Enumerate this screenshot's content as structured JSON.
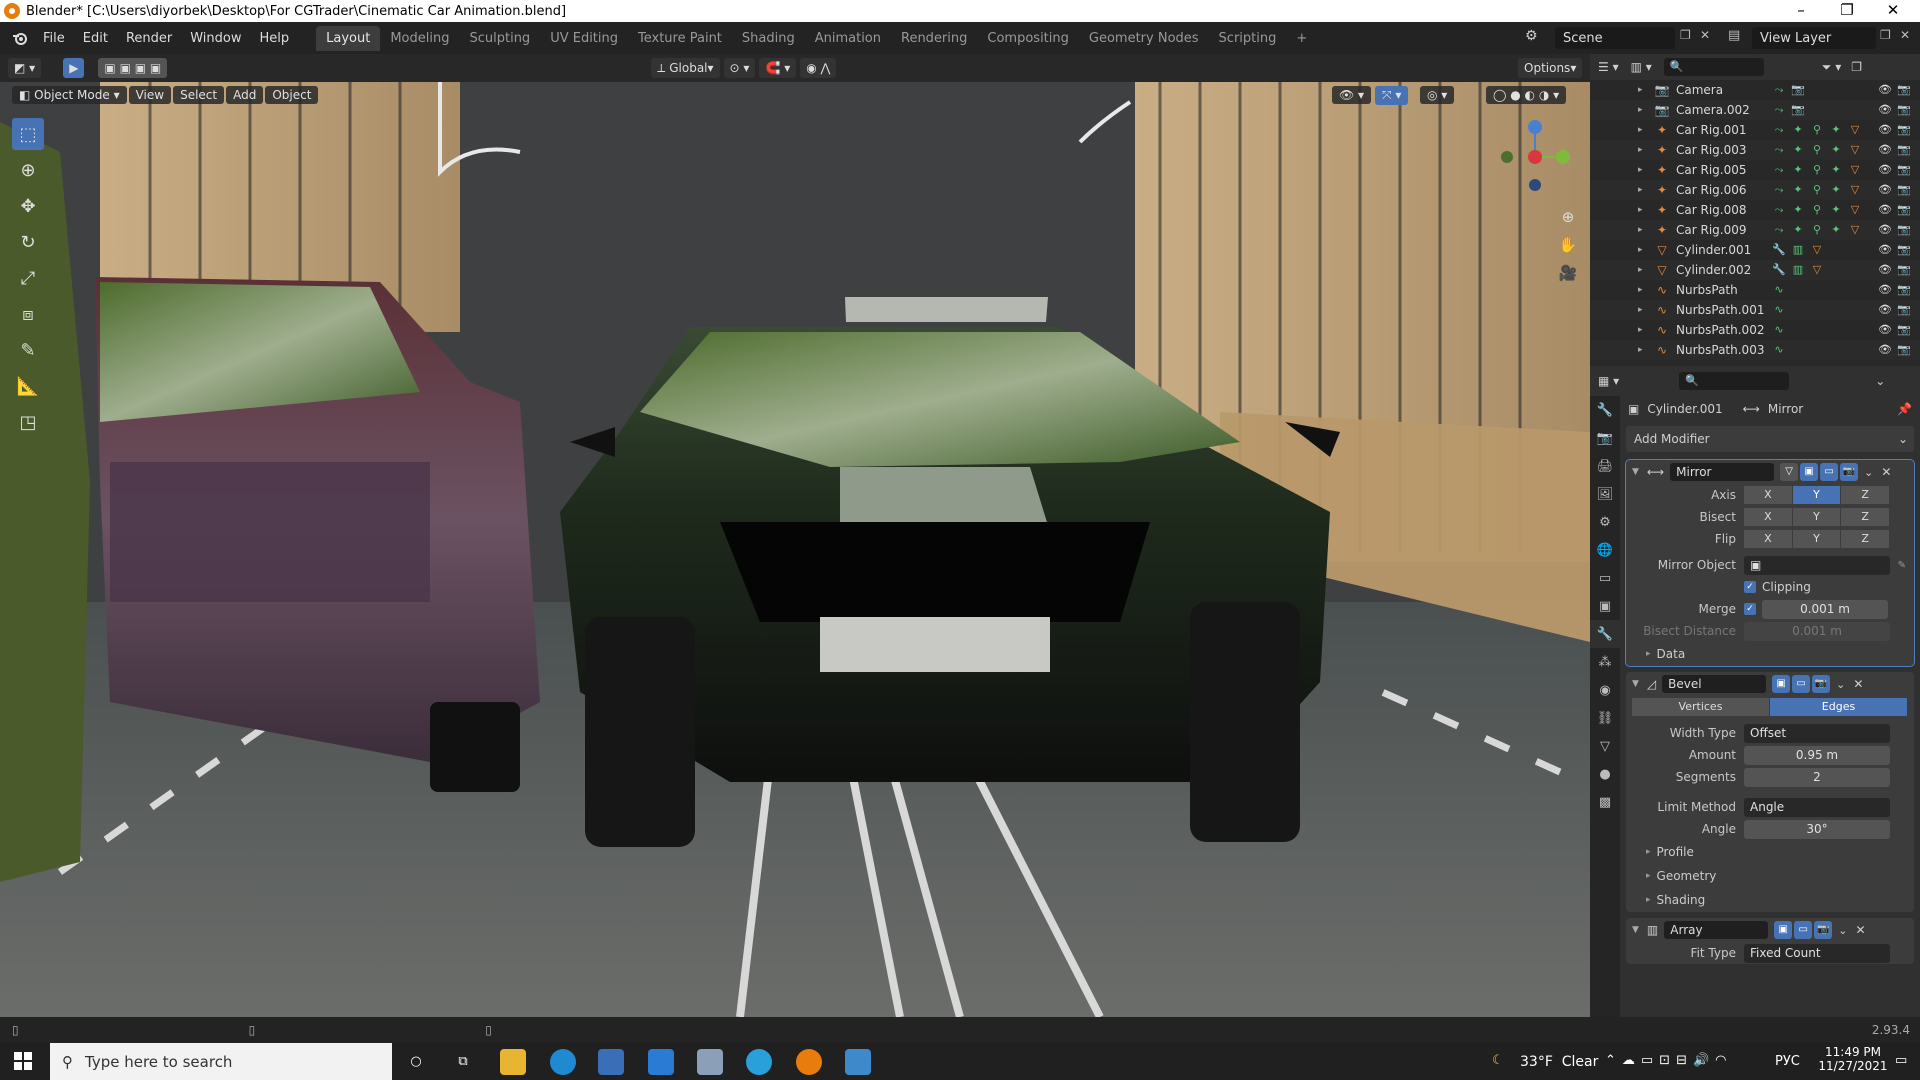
{
  "window": {
    "title": "Blender* [C:\\Users\\diyorbek\\Desktop\\For CGTrader\\Cinematic Car Animation.blend]"
  },
  "menubar": {
    "items": [
      "File",
      "Edit",
      "Render",
      "Window",
      "Help"
    ]
  },
  "workspaces": [
    "Layout",
    "Modeling",
    "Sculpting",
    "UV Editing",
    "Texture Paint",
    "Shading",
    "Animation",
    "Rendering",
    "Compositing",
    "Geometry Nodes",
    "Scripting",
    "+"
  ],
  "topright": {
    "scene": "Scene",
    "view_layer": "View Layer"
  },
  "viewport_header": {
    "orientation": "Global",
    "options": "Options"
  },
  "viewport_menu": {
    "mode": "Object Mode",
    "items": [
      "View",
      "Select",
      "Add",
      "Object"
    ]
  },
  "outliner": {
    "items": [
      {
        "label": "Camera",
        "icon": "camera-icon"
      },
      {
        "label": "Camera.002",
        "icon": "camera-icon"
      },
      {
        "label": "Car Rig.001",
        "icon": "armature-icon"
      },
      {
        "label": "Car Rig.003",
        "icon": "armature-icon"
      },
      {
        "label": "Car Rig.005",
        "icon": "armature-icon"
      },
      {
        "label": "Car Rig.006",
        "icon": "armature-icon"
      },
      {
        "label": "Car Rig.008",
        "icon": "armature-icon"
      },
      {
        "label": "Car Rig.009",
        "icon": "armature-icon"
      },
      {
        "label": "Cylinder.001",
        "icon": "mesh-icon"
      },
      {
        "label": "Cylinder.002",
        "icon": "mesh-icon"
      },
      {
        "label": "NurbsPath",
        "icon": "curve-icon"
      },
      {
        "label": "NurbsPath.001",
        "icon": "curve-icon"
      },
      {
        "label": "NurbsPath.002",
        "icon": "curve-icon"
      },
      {
        "label": "NurbsPath.003",
        "icon": "curve-icon"
      }
    ]
  },
  "properties": {
    "object": "Cylinder.001",
    "modifier_context": "Mirror",
    "add_modifier": "Add Modifier",
    "mirror": {
      "name": "Mirror",
      "axis_label": "Axis",
      "bisect_label": "Bisect",
      "flip_label": "Flip",
      "x": "X",
      "y": "Y",
      "z": "Z",
      "mirror_object_label": "Mirror Object",
      "clipping_label": "Clipping",
      "merge_label": "Merge",
      "merge_value": "0.001 m",
      "bisect_distance_label": "Bisect Distance",
      "bisect_distance_value": "0.001 m",
      "data_label": "Data"
    },
    "bevel": {
      "name": "Bevel",
      "vertices": "Vertices",
      "edges": "Edges",
      "width_type_label": "Width Type",
      "width_type_value": "Offset",
      "amount_label": "Amount",
      "amount_value": "0.95 m",
      "segments_label": "Segments",
      "segments_value": "2",
      "limit_method_label": "Limit Method",
      "limit_method_value": "Angle",
      "angle_label": "Angle",
      "angle_value": "30°",
      "profile": "Profile",
      "geometry": "Geometry",
      "shading": "Shading"
    },
    "array": {
      "name": "Array",
      "fit_type_label": "Fit Type",
      "fit_type_value": "Fixed Count"
    }
  },
  "statusbar": {
    "version": "2.93.4"
  },
  "taskbar": {
    "search_placeholder": "Type here to search",
    "weather": "33°F  Clear",
    "lang": "РУС",
    "time": "11:49 PM",
    "date": "11/27/2021"
  },
  "colors": {
    "accent": "#4772b3",
    "panel": "#303030",
    "header": "#232323"
  }
}
